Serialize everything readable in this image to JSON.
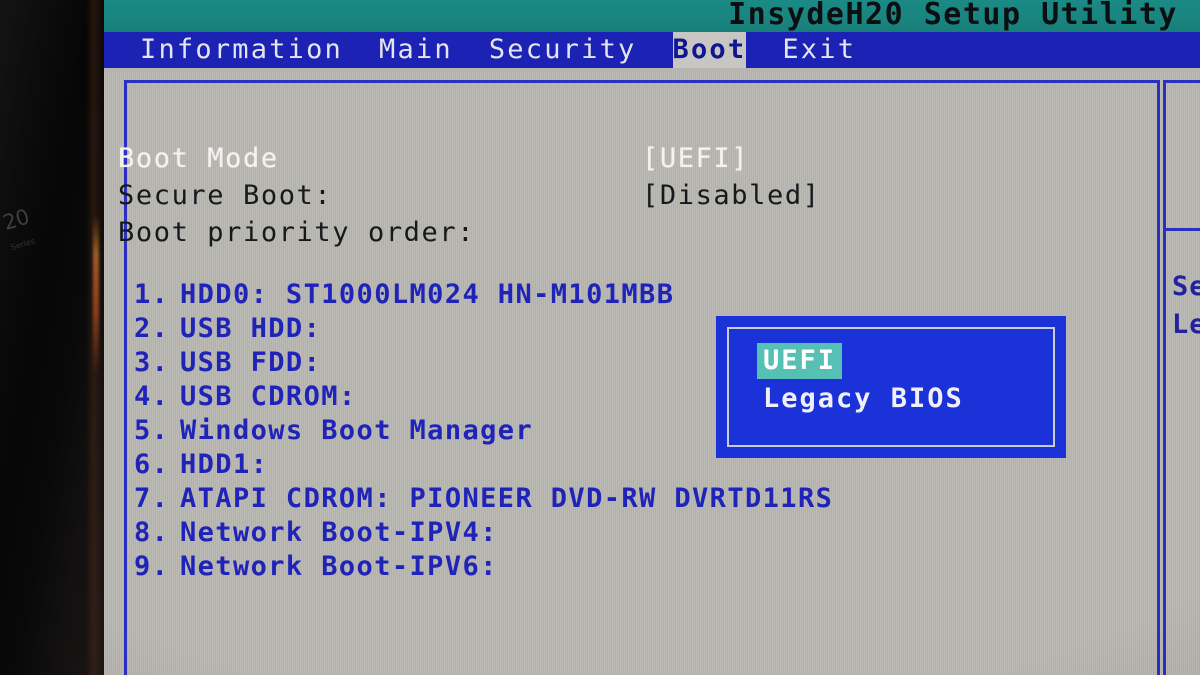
{
  "window": {
    "title": "InsydeH20 Setup Utility"
  },
  "menu": {
    "items": [
      {
        "label": "Information",
        "active": false
      },
      {
        "label": "Main",
        "active": false
      },
      {
        "label": "Security",
        "active": false
      },
      {
        "label": "Boot",
        "active": true
      },
      {
        "label": "Exit",
        "active": false
      }
    ]
  },
  "settings": [
    {
      "label": "Boot Mode",
      "value": "[UEFI]",
      "selected": true
    },
    {
      "label": "Secure Boot:",
      "value": "[Disabled]",
      "selected": false
    },
    {
      "label": "Boot priority order:",
      "value": "",
      "selected": false
    }
  ],
  "boot_priority": [
    {
      "index": "1.",
      "label": "HDD0: ST1000LM024 HN-M101MBB"
    },
    {
      "index": "2.",
      "label": "USB HDD:"
    },
    {
      "index": "3.",
      "label": "USB FDD:"
    },
    {
      "index": "4.",
      "label": "USB CDROM:"
    },
    {
      "index": "5.",
      "label": "Windows Boot Manager"
    },
    {
      "index": "6.",
      "label": "HDD1:"
    },
    {
      "index": "7.",
      "label": "ATAPI CDROM: PIONEER DVD-RW DVRTD11RS"
    },
    {
      "index": "8.",
      "label": "Network Boot-IPV4:"
    },
    {
      "index": "9.",
      "label": "Network Boot-IPV6:"
    }
  ],
  "popup": {
    "options": [
      {
        "label": "UEFI",
        "selected": true
      },
      {
        "label": "Legacy BIOS",
        "selected": false
      }
    ]
  },
  "help_pane": {
    "lines": [
      "Se",
      "Le"
    ]
  },
  "bezel": {
    "sticker": "20",
    "sticker_sub": "Series"
  },
  "colors": {
    "title_bar": "#1a8580",
    "menu_bar": "#1c22b4",
    "screen_bg": "#bab7b2",
    "frame_border": "#2b2fc0",
    "boot_text": "#1f23b8",
    "popup_bg": "#1b32d8",
    "popup_highlight": "#57c0b4",
    "active_tab_bg": "#c8c6c3"
  }
}
